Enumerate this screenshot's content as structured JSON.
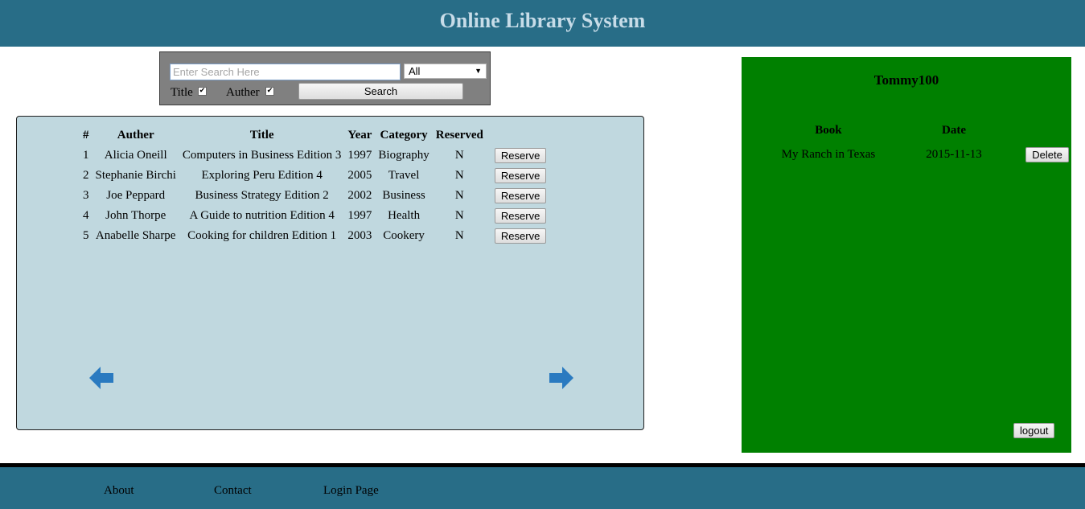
{
  "header": {
    "title": "Online Library System"
  },
  "search": {
    "placeholder": "Enter Search Here",
    "value": "",
    "filter_selected": "All",
    "title_label": "Title",
    "title_checked": true,
    "author_label": "Auther",
    "author_checked": true,
    "button_label": "Search"
  },
  "books": {
    "columns": [
      "#",
      "Auther",
      "Title",
      "Year",
      "Category",
      "Reserved"
    ],
    "rows": [
      {
        "num": "1",
        "author": "Alicia Oneill",
        "title": "Computers in Business Edition 3",
        "year": "1997",
        "category": "Biography",
        "reserved": "N",
        "action": "Reserve"
      },
      {
        "num": "2",
        "author": "Stephanie Birchi",
        "title": "Exploring Peru Edition 4",
        "year": "2005",
        "category": "Travel",
        "reserved": "N",
        "action": "Reserve"
      },
      {
        "num": "3",
        "author": "Joe Peppard",
        "title": "Business Strategy Edition 2",
        "year": "2002",
        "category": "Business",
        "reserved": "N",
        "action": "Reserve"
      },
      {
        "num": "4",
        "author": "John Thorpe",
        "title": "A Guide to nutrition Edition 4",
        "year": "1997",
        "category": "Health",
        "reserved": "N",
        "action": "Reserve"
      },
      {
        "num": "5",
        "author": "Anabelle Sharpe",
        "title": "Cooking for children Edition 1",
        "year": "2003",
        "category": "Cookery",
        "reserved": "N",
        "action": "Reserve"
      }
    ],
    "prev_icon": "arrow-left-icon",
    "next_icon": "arrow-right-icon"
  },
  "user": {
    "name": "Tommy100",
    "columns": [
      "Book",
      "Date"
    ],
    "reservations": [
      {
        "book": "My Ranch in Texas",
        "date": "2015-11-13",
        "action": "Delete"
      }
    ],
    "logout_label": "logout"
  },
  "footer": {
    "links": [
      "About",
      "Contact",
      "Login Page"
    ]
  },
  "colors": {
    "header_bg": "#286d87",
    "header_text": "#c7dce8",
    "books_panel_bg": "#c0d8df",
    "user_panel_bg": "#008000",
    "arrow": "#2a7ac0",
    "search_box_bg": "#808080"
  }
}
